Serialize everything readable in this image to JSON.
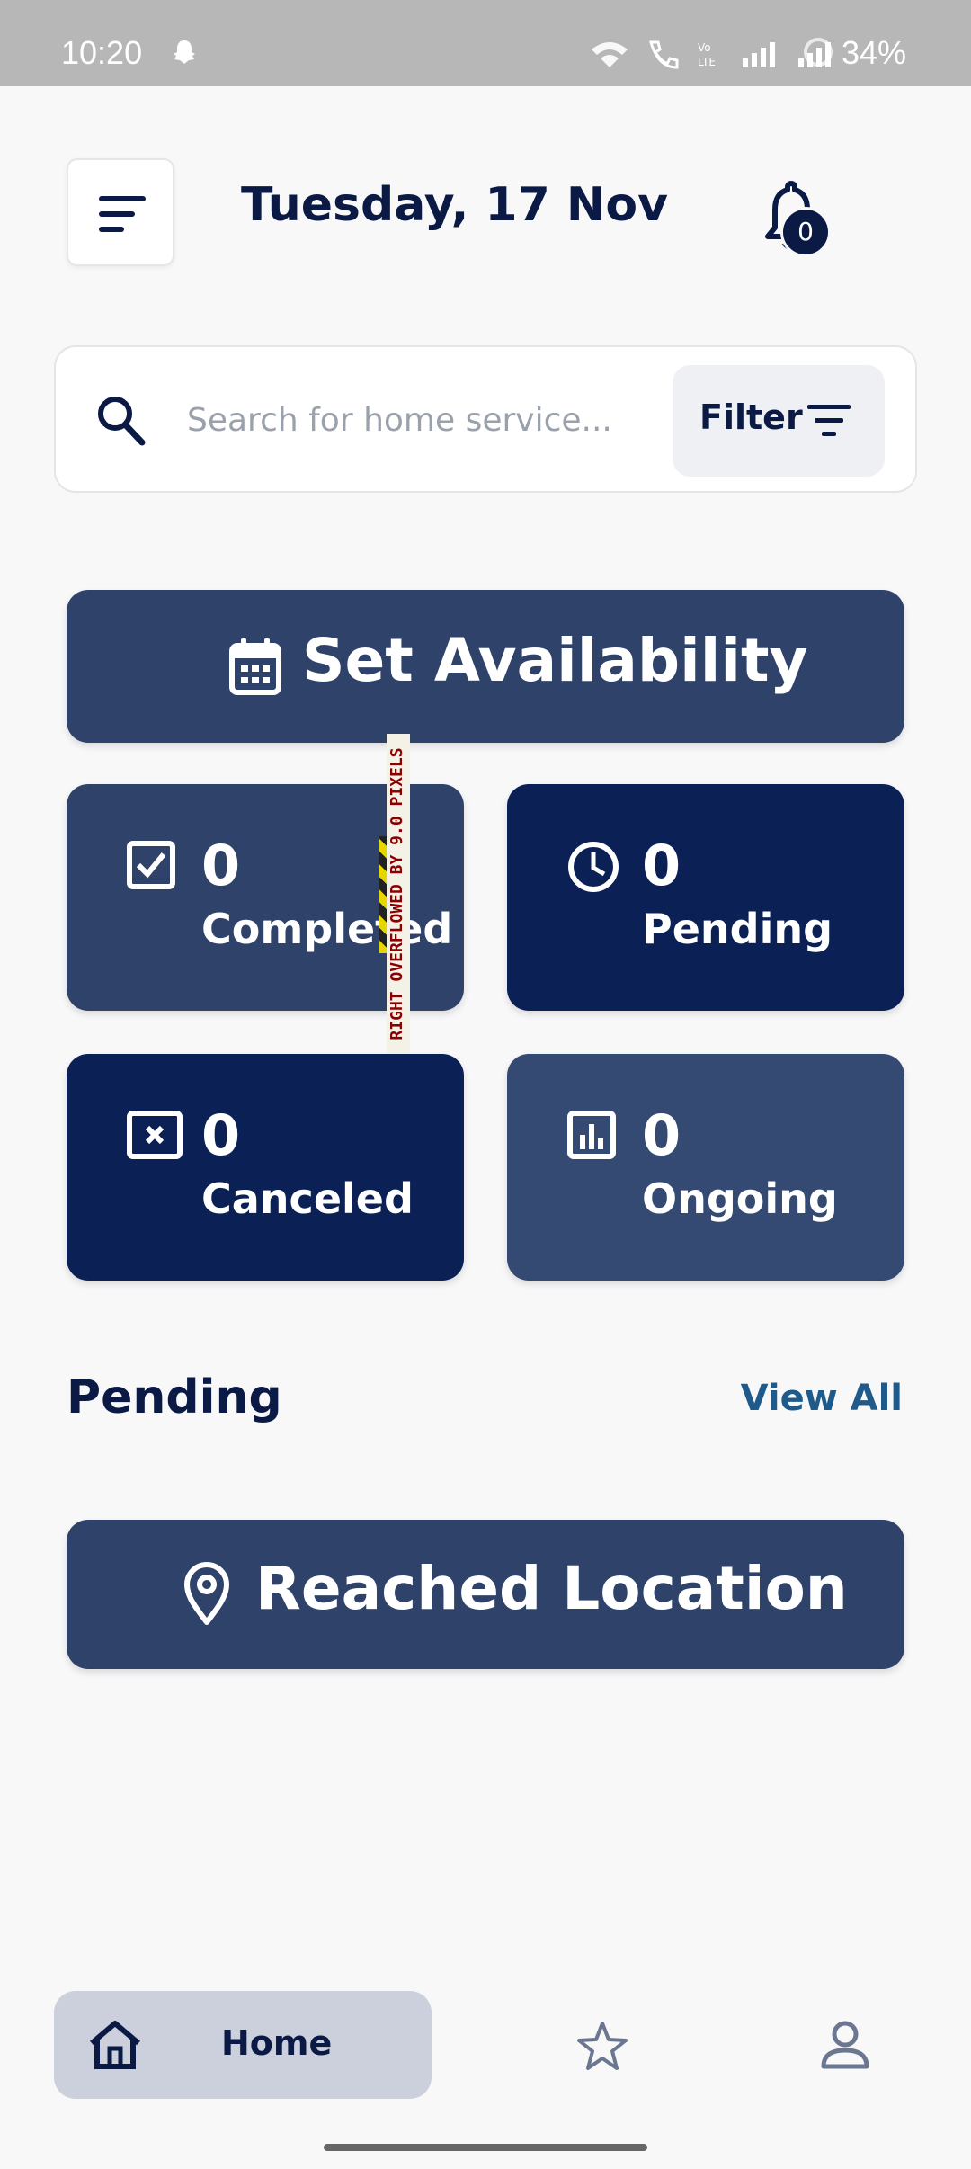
{
  "status_bar": {
    "time": "10:20",
    "battery": "34%"
  },
  "header": {
    "date": "Tuesday, 17 Nov",
    "notification_count": "0"
  },
  "search": {
    "placeholder": "Search for home service...",
    "filter_label": "Filter"
  },
  "set_availability_label": "Set Availability",
  "stats": [
    {
      "count": "0",
      "label": "Completed",
      "icon": "checkbox-icon"
    },
    {
      "count": "0",
      "label": "Pending",
      "icon": "clock-icon"
    },
    {
      "count": "0",
      "label": "Canceled",
      "icon": "close-box-icon"
    },
    {
      "count": "0",
      "label": "Ongoing",
      "icon": "bar-chart-icon"
    }
  ],
  "debug_overflow_text": "RIGHT OVERFLOWED BY 9.0 PIXELS",
  "pending_section": {
    "title": "Pending",
    "view_all": "View All"
  },
  "reached_location_label": "Reached Location",
  "bottom_nav": {
    "home_label": "Home"
  },
  "colors": {
    "primary": "#0b2054",
    "secondary": "#2f4269",
    "accent_link": "#1f5a8a",
    "background": "#f8f8f9"
  }
}
